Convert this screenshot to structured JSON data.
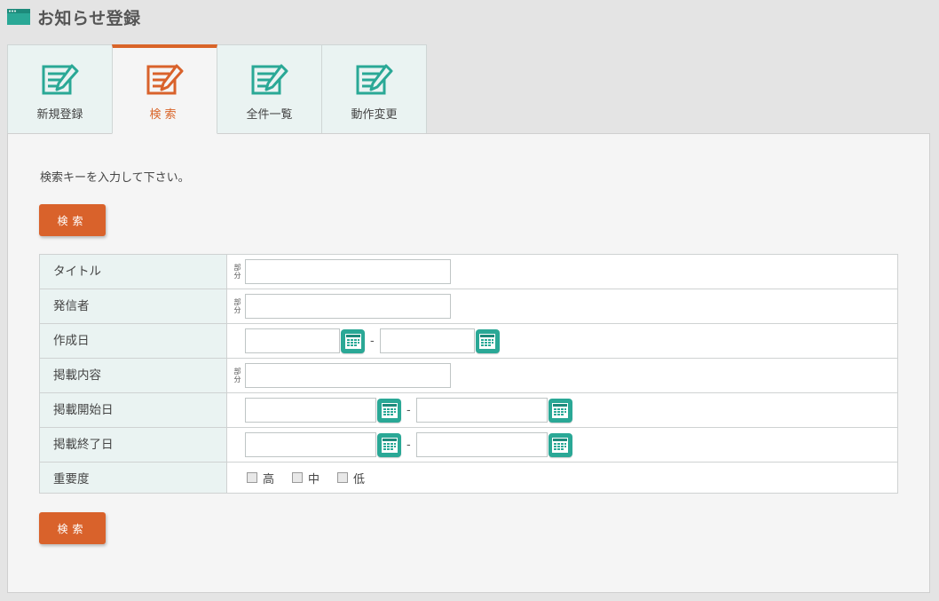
{
  "header": {
    "title": "お知らせ登録",
    "icon": "window-icon"
  },
  "tabs": [
    {
      "label": "新規登録",
      "icon": "edit-note-icon",
      "active": false
    },
    {
      "label": "検索",
      "icon": "edit-note-icon",
      "active": true
    },
    {
      "label": "全件一覧",
      "icon": "edit-note-icon",
      "active": false
    },
    {
      "label": "動作変更",
      "icon": "edit-note-icon",
      "active": false
    }
  ],
  "main": {
    "instruction": "検索キーを入力して下さい。",
    "search_button": "検索",
    "partial_label_1": "部",
    "partial_label_2": "分",
    "date_separator": "-",
    "fields": {
      "title": "タイトル",
      "sender": "発信者",
      "created_date": "作成日",
      "content": "掲載内容",
      "start_date": "掲載開始日",
      "end_date": "掲載終了日",
      "importance": "重要度"
    },
    "importance_options": [
      "高",
      "中",
      "低"
    ]
  },
  "colors": {
    "accent": "#d9622b",
    "teal": "#2aa896",
    "tab_bg": "#eaf3f2",
    "panel_bg": "#f5f5f5"
  }
}
